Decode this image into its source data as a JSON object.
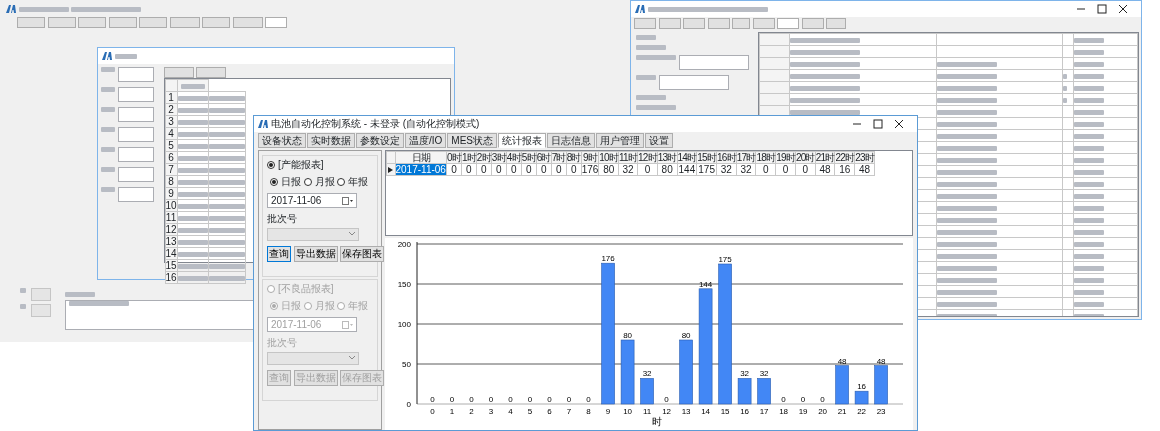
{
  "back_left_window": {
    "tabs": [
      {
        "selected": false
      },
      {
        "selected": false
      },
      {
        "selected": false
      },
      {
        "selected": false
      },
      {
        "selected": false
      },
      {
        "selected": false
      },
      {
        "selected": false
      },
      {
        "selected": false
      },
      {
        "selected": true
      }
    ]
  },
  "back_right_window": {
    "tabs": [
      {
        "selected": false
      },
      {
        "selected": false
      },
      {
        "selected": false
      },
      {
        "selected": false
      },
      {
        "selected": false
      },
      {
        "selected": false
      },
      {
        "selected": true
      },
      {
        "selected": false
      },
      {
        "selected": false
      }
    ]
  },
  "back_dialog": {
    "row_numbers": [
      "1",
      "2",
      "3",
      "4",
      "5",
      "6",
      "7",
      "8",
      "9",
      "10",
      "11",
      "12",
      "13",
      "14",
      "15",
      "16"
    ]
  },
  "front_window": {
    "title": "电池自动化控制系统 - 未登录 (自动化控制模式)",
    "tabs": [
      {
        "label": "设备状态",
        "selected": false
      },
      {
        "label": "实时数据",
        "selected": false
      },
      {
        "label": "参数设定",
        "selected": false
      },
      {
        "label": "温度/IO",
        "selected": false
      },
      {
        "label": "MES状态",
        "selected": false
      },
      {
        "label": "统计报表",
        "selected": true
      },
      {
        "label": "日志信息",
        "selected": false
      },
      {
        "label": "用户管理",
        "selected": false
      },
      {
        "label": "设置",
        "selected": false
      }
    ],
    "report_groups": [
      {
        "label": "[产能报表]",
        "selected": true,
        "disabled": false,
        "periods": [
          {
            "label": "日报",
            "selected": true
          },
          {
            "label": "月报",
            "selected": false
          },
          {
            "label": "年报",
            "selected": false
          }
        ],
        "date": "2017-11-06",
        "batch_label": "批次号",
        "buttons": [
          "查询",
          "导出数据",
          "保存图表"
        ]
      },
      {
        "label": "[不良品报表]",
        "selected": false,
        "disabled": true,
        "periods": [
          {
            "label": "日报",
            "selected": true
          },
          {
            "label": "月报",
            "selected": false
          },
          {
            "label": "年报",
            "selected": false
          }
        ],
        "date": "2017-11-06",
        "batch_label": "批次号",
        "buttons": [
          "查询",
          "导出数据",
          "保存图表"
        ]
      }
    ],
    "table": {
      "columns": [
        "日期",
        "0时",
        "1时",
        "2时",
        "3时",
        "4时",
        "5时",
        "6时",
        "7时",
        "8时",
        "9时",
        "10时",
        "11时",
        "12时",
        "13时",
        "14时",
        "15时",
        "16时",
        "17时",
        "18时",
        "19时",
        "20时",
        "21时",
        "22时",
        "23时"
      ],
      "rows": [
        {
          "selected": true,
          "cells": [
            "2017-11-06",
            "0",
            "0",
            "0",
            "0",
            "0",
            "0",
            "0",
            "0",
            "0",
            "176",
            "80",
            "32",
            "0",
            "80",
            "144",
            "175",
            "32",
            "32",
            "0",
            "0",
            "0",
            "48",
            "16",
            "48"
          ]
        }
      ]
    },
    "chart_data": {
      "type": "bar",
      "xlabel": "时",
      "categories": [
        "0",
        "1",
        "2",
        "3",
        "4",
        "5",
        "6",
        "7",
        "8",
        "9",
        "10",
        "11",
        "12",
        "13",
        "14",
        "15",
        "16",
        "17",
        "18",
        "19",
        "20",
        "21",
        "22",
        "23"
      ],
      "values": [
        0,
        0,
        0,
        0,
        0,
        0,
        0,
        0,
        0,
        176,
        80,
        32,
        0,
        80,
        144,
        175,
        32,
        32,
        0,
        0,
        0,
        48,
        16,
        48
      ],
      "ylim": [
        0,
        200
      ],
      "grid": true,
      "yticks": [
        0,
        50,
        100,
        150,
        200
      ],
      "data_labels": true
    }
  }
}
